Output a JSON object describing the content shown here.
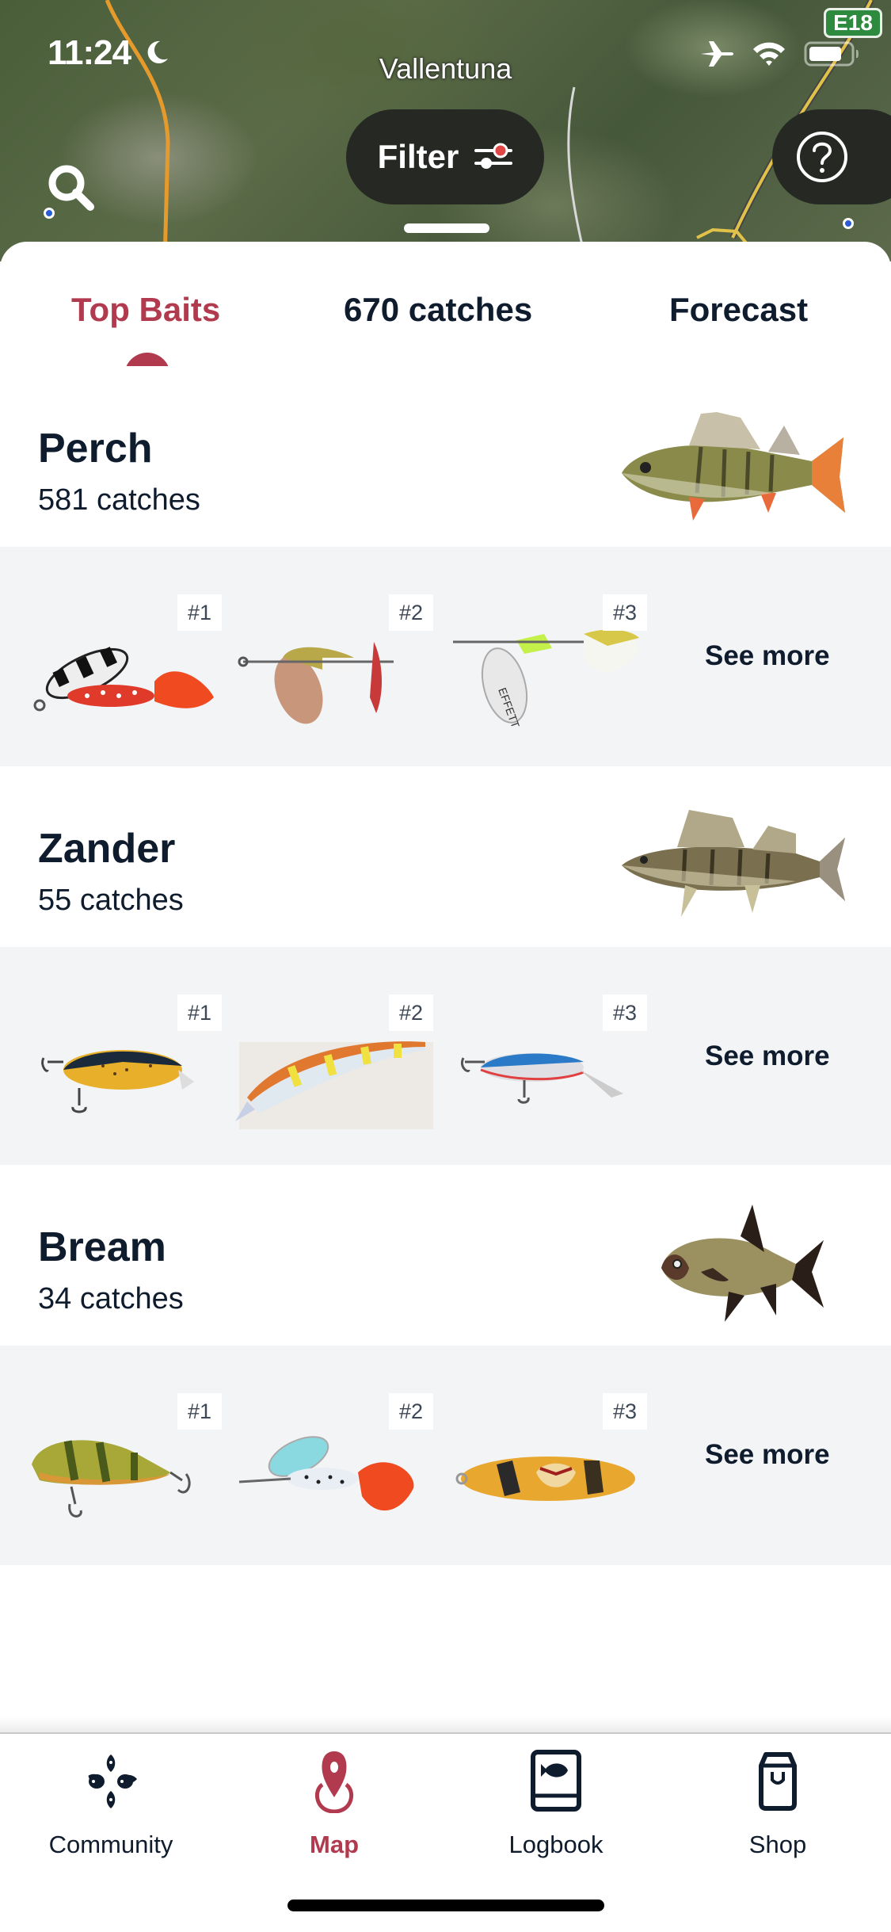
{
  "status_bar": {
    "time": "11:24",
    "icons": [
      "moon-icon",
      "airplane-icon",
      "wifi-icon",
      "battery-icon"
    ]
  },
  "map": {
    "place_label": "Vallentuna",
    "road_sign": "E18",
    "filter_label": "Filter",
    "icons": [
      "search-icon",
      "sliders-icon",
      "help-icon"
    ]
  },
  "tabs": [
    {
      "label": "Top Baits",
      "active": true
    },
    {
      "label": "670 catches",
      "active": false
    },
    {
      "label": "Forecast",
      "active": false
    }
  ],
  "species": [
    {
      "name": "Perch",
      "count": "581 catches",
      "baits": [
        {
          "rank": "#1",
          "type": "spinner-striped-red"
        },
        {
          "rank": "#2",
          "type": "spinner-copper-blade"
        },
        {
          "rank": "#3",
          "type": "spinner-silver-chartreuse"
        }
      ],
      "see_more": "See more"
    },
    {
      "name": "Zander",
      "count": "55 catches",
      "baits": [
        {
          "rank": "#1",
          "type": "crankbait-yellow-spotted"
        },
        {
          "rank": "#2",
          "type": "jerkbait-orange-stripe"
        },
        {
          "rank": "#3",
          "type": "crankbait-blue-silver"
        }
      ],
      "see_more": "See more"
    },
    {
      "name": "Bream",
      "count": "34 catches",
      "baits": [
        {
          "rank": "#1",
          "type": "crankbait-perch-pattern"
        },
        {
          "rank": "#2",
          "type": "spinner-blue-red-tail"
        },
        {
          "rank": "#3",
          "type": "float-bird-print"
        }
      ],
      "see_more": "See more"
    }
  ],
  "bottom_nav": [
    {
      "label": "Community",
      "icon": "community-icon",
      "active": false
    },
    {
      "label": "Map",
      "icon": "map-pin-icon",
      "active": true
    },
    {
      "label": "Logbook",
      "icon": "logbook-icon",
      "active": false
    },
    {
      "label": "Shop",
      "icon": "shopping-bag-icon",
      "active": false
    }
  ],
  "colors": {
    "accent": "#b23a4e",
    "text": "#0f1c2e",
    "bait_bg": "#f3f4f6",
    "pill_bg": "#262823"
  }
}
